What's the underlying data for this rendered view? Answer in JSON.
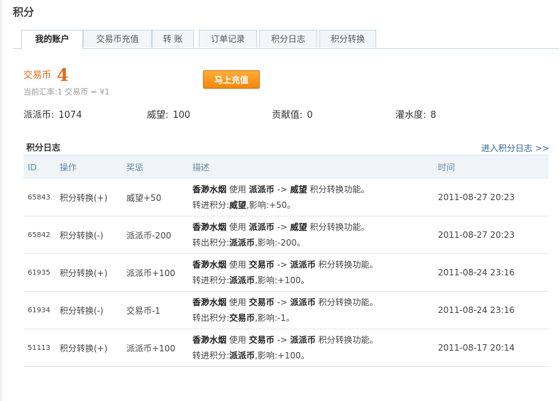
{
  "page": {
    "title": "积分"
  },
  "tabs": [
    {
      "label": "我的账户",
      "active": true
    },
    {
      "label": "交易币充值",
      "active": false
    },
    {
      "label": "转 账",
      "active": false
    },
    {
      "label": "订单记录",
      "active": false
    },
    {
      "label": "积分日志",
      "active": false
    },
    {
      "label": "积分转换",
      "active": false
    }
  ],
  "account": {
    "currency_label": "交易币",
    "currency_value": "4",
    "exchange_rate": "当前汇率:1 交易币 = ¥1",
    "recharge_button": "马上充值"
  },
  "stats": [
    {
      "label": "派派币:",
      "value": "1074"
    },
    {
      "label": "威望:",
      "value": "100"
    },
    {
      "label": "贡献值:",
      "value": "0"
    },
    {
      "label": "灌水度:",
      "value": "8"
    }
  ],
  "log": {
    "title": "积分日志",
    "more_link": "进入积分日志 >>",
    "columns": [
      "ID",
      "操作",
      "奖惩",
      "描述",
      "时间"
    ],
    "rows": [
      {
        "id": "65843",
        "operation": "积分转换(+)",
        "reward": "威望+50",
        "desc": {
          "user": "香渺水烟",
          "use": " 使用 ",
          "from": "派派币",
          "arrow": " -> ",
          "to": "威望",
          "suffix": " 积分转换功能。",
          "line2_prefix": "转进积分:",
          "line2_currency": "威望",
          "line2_suffix": ",影响:+50。"
        },
        "time": "2011-08-27 20:23"
      },
      {
        "id": "65842",
        "operation": "积分转换(-)",
        "reward": "派派币-200",
        "desc": {
          "user": "香渺水烟",
          "use": " 使用 ",
          "from": "派派币",
          "arrow": " -> ",
          "to": "威望",
          "suffix": " 积分转换功能。",
          "line2_prefix": "转出积分:",
          "line2_currency": "派派币",
          "line2_suffix": ",影响:-200。"
        },
        "time": "2011-08-27 20:23"
      },
      {
        "id": "61935",
        "operation": "积分转换(+)",
        "reward": "派派币+100",
        "desc": {
          "user": "香渺水烟",
          "use": " 使用 ",
          "from": "交易币",
          "arrow": " -> ",
          "to": "派派币",
          "suffix": " 积分转换功能。",
          "line2_prefix": "转进积分:",
          "line2_currency": "派派币",
          "line2_suffix": ",影响:+100。"
        },
        "time": "2011-08-24 23:16"
      },
      {
        "id": "61934",
        "operation": "积分转换(-)",
        "reward": "交易币-1",
        "desc": {
          "user": "香渺水烟",
          "use": " 使用 ",
          "from": "交易币",
          "arrow": " -> ",
          "to": "派派币",
          "suffix": " 积分转换功能。",
          "line2_prefix": "转出积分:",
          "line2_currency": "交易币",
          "line2_suffix": ",影响:-1。"
        },
        "time": "2011-08-24 23:16"
      },
      {
        "id": "51113",
        "operation": "积分转换(+)",
        "reward": "派派币+100",
        "desc": {
          "user": "香渺水烟",
          "use": " 使用 ",
          "from": "交易币",
          "arrow": " -> ",
          "to": "派派币",
          "suffix": " 积分转换功能。",
          "line2_prefix": "转进积分:",
          "line2_currency": "派派币",
          "line2_suffix": ",影响:+100。"
        },
        "time": "2011-08-17 20:14"
      }
    ]
  },
  "colors": {
    "accent": "#e06a14",
    "button": "#f3860c",
    "link": "#336699",
    "header_bg": "#eef4f8"
  }
}
